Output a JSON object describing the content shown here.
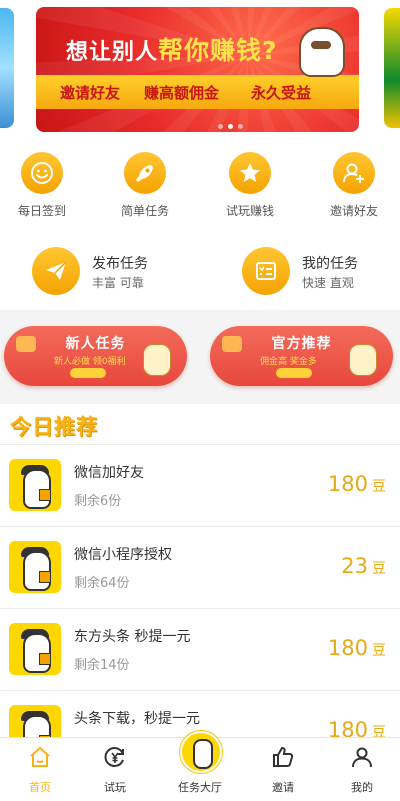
{
  "banner": {
    "headline_pre": "想让别人",
    "headline_highlight": "帮你赚钱?",
    "slogans": [
      "邀请好友",
      "赚高额佣金",
      "永久受益"
    ]
  },
  "quick": [
    {
      "label": "每日签到",
      "icon": "smile-icon"
    },
    {
      "label": "简单任务",
      "icon": "rocket-icon"
    },
    {
      "label": "试玩赚钱",
      "icon": "star-icon"
    },
    {
      "label": "邀请好友",
      "icon": "add-user-icon"
    }
  ],
  "actions": {
    "publish": {
      "title": "发布任务",
      "subtitle": "丰富 可靠",
      "icon": "paper-plane-icon"
    },
    "mine": {
      "title": "我的任务",
      "subtitle": "快速 直观",
      "icon": "checklist-icon"
    }
  },
  "promos": [
    {
      "title": "新人任务",
      "subtitle": "新人必做 领0福利"
    },
    {
      "title": "官方推荐",
      "subtitle": "佣金高 奖金多"
    }
  ],
  "section_title": "今日推荐",
  "tasks": [
    {
      "name": "微信加好友",
      "remaining": "剩余6份",
      "value": "180",
      "unit": "豆"
    },
    {
      "name": "微信小程序授权",
      "remaining": "剩余64份",
      "value": "23",
      "unit": "豆"
    },
    {
      "name": "东方头条 秒提一元",
      "remaining": "剩余14份",
      "value": "180",
      "unit": "豆"
    },
    {
      "name": "头条下载，秒提一元",
      "remaining": "",
      "value": "180",
      "unit": "豆"
    }
  ],
  "nav": [
    {
      "label": "首页",
      "icon": "home-icon",
      "active": true
    },
    {
      "label": "试玩",
      "icon": "yen-cycle-icon",
      "active": false
    },
    {
      "label": "任务大厅",
      "icon": "mascot-icon",
      "active": false
    },
    {
      "label": "邀请",
      "icon": "thumbs-up-icon",
      "active": false
    },
    {
      "label": "我的",
      "icon": "user-icon",
      "active": false
    }
  ],
  "colors": {
    "accent": "#f7b417",
    "banner_red": "#e82a2a",
    "promo_red": "#e8473c"
  }
}
